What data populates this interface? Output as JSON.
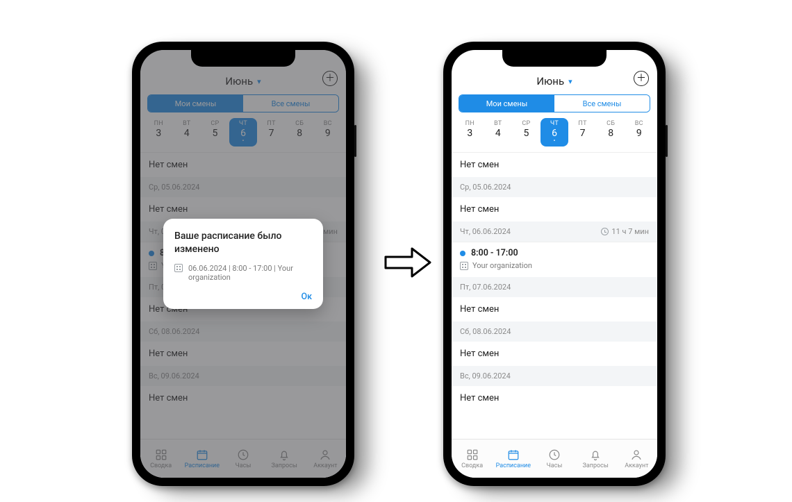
{
  "header": {
    "month": "Июнь"
  },
  "segmented": {
    "my": "Мои смены",
    "all": "Все смены"
  },
  "week": [
    {
      "dow": "ПН",
      "num": "3"
    },
    {
      "dow": "ВТ",
      "num": "4"
    },
    {
      "dow": "СР",
      "num": "5"
    },
    {
      "dow": "ЧТ",
      "num": "6",
      "selected": true,
      "has_dot": true
    },
    {
      "dow": "ПТ",
      "num": "7"
    },
    {
      "dow": "СБ",
      "num": "8"
    },
    {
      "dow": "ВС",
      "num": "9"
    }
  ],
  "labels": {
    "no_shifts": "Нет смен"
  },
  "dates": {
    "wed": "Ср, 05.06.2024",
    "thu": "Чт, 06.06.2024",
    "fri": "Пт, 07.06.2024",
    "sat": "Сб, 08.06.2024",
    "sun": "Вс, 09.06.2024"
  },
  "thu_detail": {
    "duration": "11 ч 7 мин",
    "time": "8:00 - 17:00",
    "org": "Your organization"
  },
  "tabs": {
    "summary": "Сводка",
    "schedule": "Расписание",
    "hours": "Часы",
    "requests": "Запросы",
    "account": "Аккаунт"
  },
  "dialog": {
    "title": "Ваше расписание было изменено",
    "body": "06.06.2024 | 8:00 - 17:00 | Your organization",
    "ok": "Ок"
  }
}
